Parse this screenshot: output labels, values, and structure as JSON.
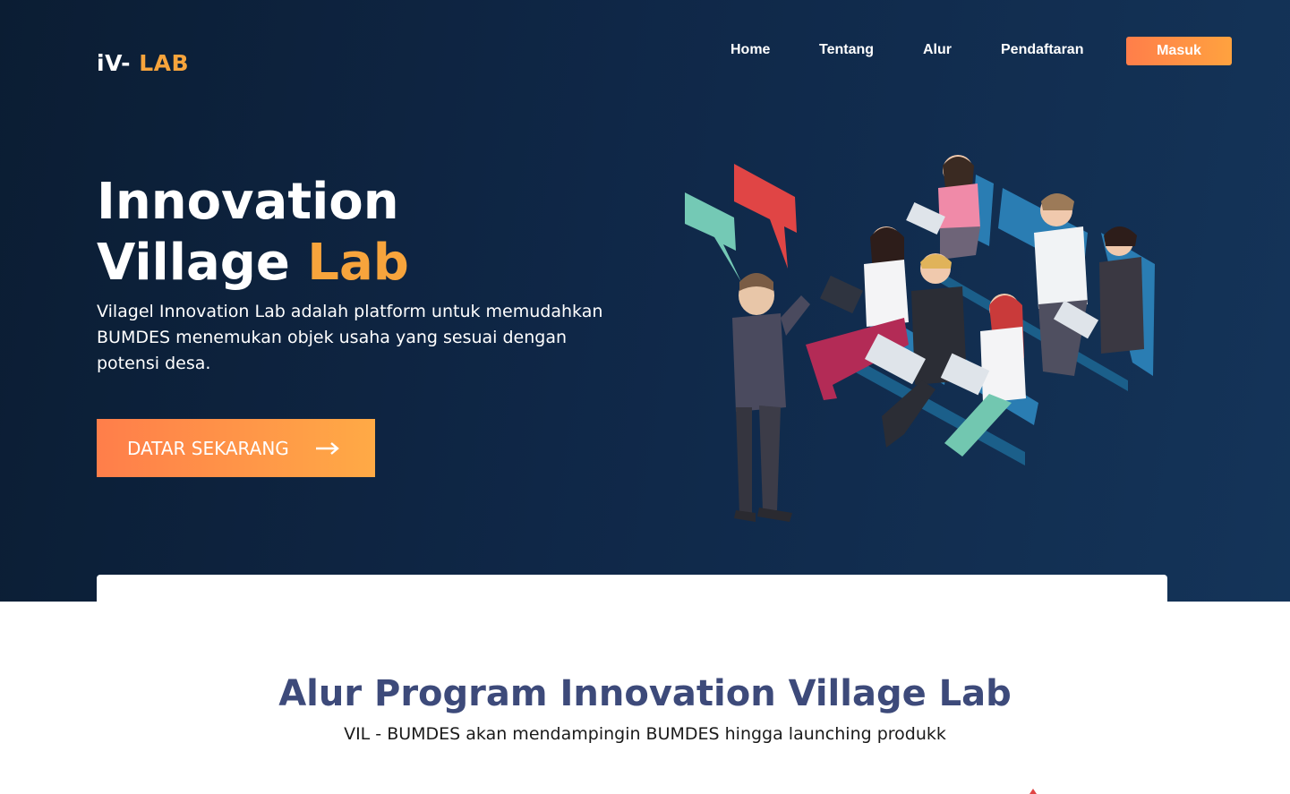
{
  "brand": {
    "prefix": "iV-",
    "accent": "LAB"
  },
  "nav": {
    "items": [
      "Home",
      "Tentang",
      "Alur",
      "Pendaftaran"
    ],
    "login_label": "Masuk"
  },
  "hero": {
    "title_line1": "Innovation",
    "title_line2_plain": "Village",
    "title_line2_accent": "Lab",
    "description": "Vilagel Innovation Lab  adalah platform untuk memudahkan BUMDES menemukan objek usaha yang sesuai dengan potensi desa.",
    "cta_label": "DATAR SEKARANG",
    "cta_icon": "arrow-right-icon",
    "illustration": "presentation-illustration"
  },
  "section": {
    "title": "Alur Program Innovation Village Lab",
    "subtitle": "VIL - BUMDES akan mendampingin BUMDES hingga launching produkk"
  },
  "colors": {
    "hero_bg_start": "#0b1d33",
    "hero_bg_end": "#143459",
    "accent": "#f7a43c",
    "button_gradient_start": "#ff7e4a",
    "button_gradient_end": "#ffa23f",
    "section_title": "#3d4a7a"
  }
}
